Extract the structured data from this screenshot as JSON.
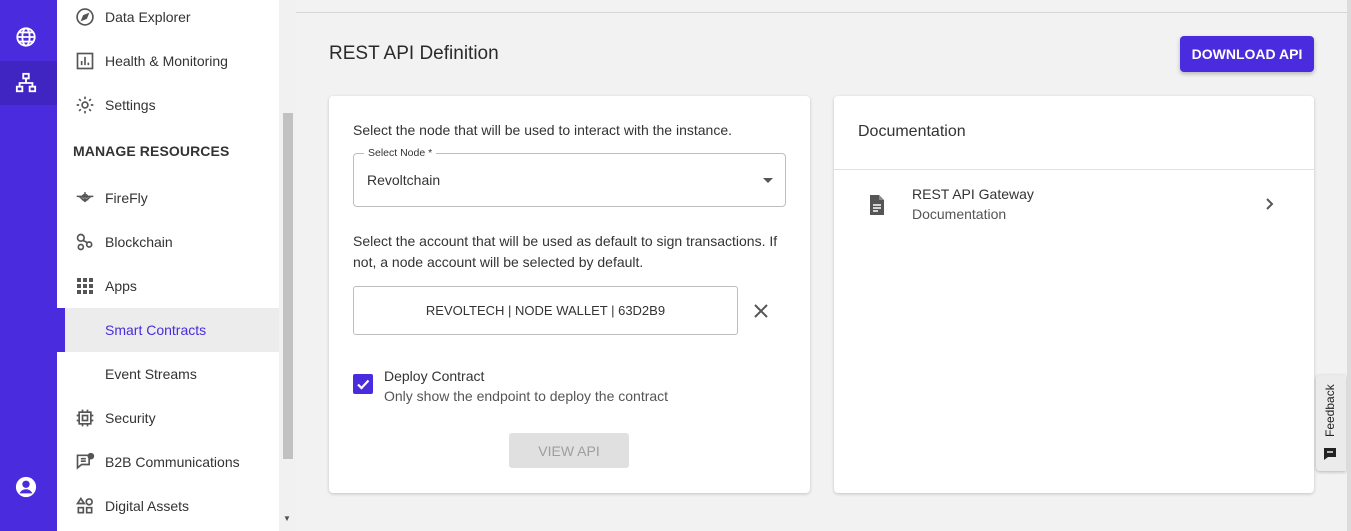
{
  "colors": {
    "primary": "#4a2bdd",
    "rail": "#4a2bdd"
  },
  "rail": {
    "icons": [
      "globe-icon",
      "network-icon",
      "account-circle-icon"
    ]
  },
  "sidebar": {
    "items": [
      {
        "label": "Data Explorer",
        "icon": "compass-icon"
      },
      {
        "label": "Health & Monitoring",
        "icon": "bar-chart-icon"
      },
      {
        "label": "Settings",
        "icon": "gear-icon"
      },
      {
        "label": "FireFly",
        "icon": "firefly-icon"
      },
      {
        "label": "Blockchain",
        "icon": "blockchain-icon"
      },
      {
        "label": "Apps",
        "icon": "apps-grid-icon"
      },
      {
        "label": "Smart Contracts",
        "icon": ""
      },
      {
        "label": "Event Streams",
        "icon": ""
      },
      {
        "label": "Security",
        "icon": "chip-icon"
      },
      {
        "label": "B2B Communications",
        "icon": "chat-icon"
      },
      {
        "label": "Digital Assets",
        "icon": "shapes-icon"
      }
    ],
    "section_heading": "MANAGE RESOURCES",
    "active_item": "Smart Contracts"
  },
  "header": {
    "title": "REST API Definition",
    "download_label": "DOWNLOAD API"
  },
  "form": {
    "node_prompt": "Select the node that will be used to interact with the instance.",
    "node_label": "Select Node *",
    "node_value": "Revoltchain",
    "account_prompt": "Select the account that will be used as default to sign transactions. If not, a node account will be selected by default.",
    "account_value": "REVOLTECH | NODE WALLET | 63D2B9",
    "deploy_title": "Deploy Contract",
    "deploy_subtitle": "Only show the endpoint to deploy the contract",
    "deploy_checked": true,
    "view_label": "VIEW API"
  },
  "documentation": {
    "heading": "Documentation",
    "item_title": "REST API Gateway",
    "item_subtitle": "Documentation"
  },
  "feedback": {
    "label": "Feedback"
  }
}
